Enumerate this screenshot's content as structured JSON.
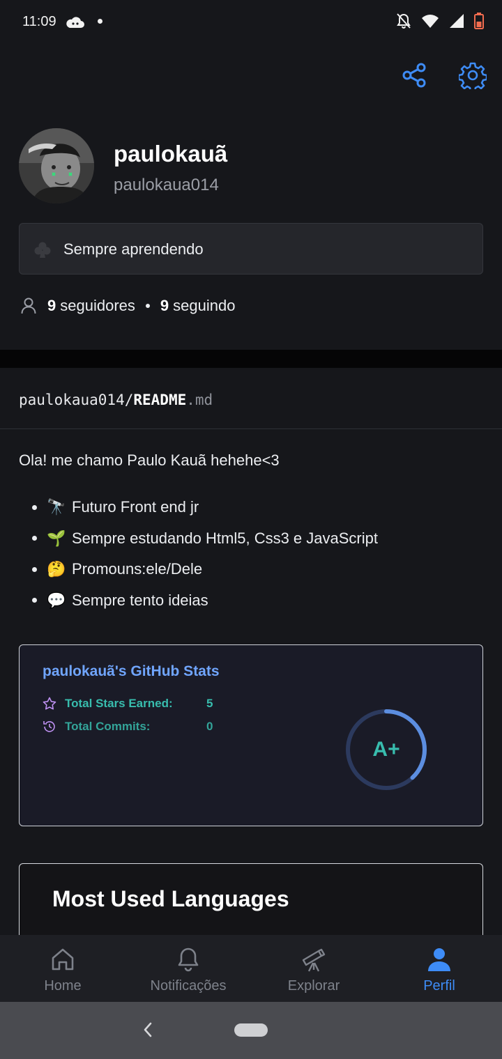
{
  "status_bar": {
    "time": "11:09"
  },
  "profile": {
    "name": "paulokauã",
    "login": "paulokaua014",
    "status_text": "Sempre aprendendo",
    "followers_count": "9",
    "followers_label": "seguidores",
    "following_count": "9",
    "following_label": "seguindo"
  },
  "readme": {
    "path_prefix": "paulokaua014/",
    "path_file": "README",
    "path_ext": ".md",
    "intro": "Ola! me chamo Paulo Kauã hehehe<3",
    "bullets": [
      {
        "emoji": "🔭",
        "text": "Futuro Front end jr"
      },
      {
        "emoji": "🌱",
        "text": "Sempre estudando Html5, Css3 e JavaScript"
      },
      {
        "emoji": "🤔",
        "text": "Promouns:ele/Dele"
      },
      {
        "emoji": "💬",
        "text": "Sempre tento ideias"
      }
    ]
  },
  "stats_card": {
    "title": "paulokauã's GitHub Stats",
    "rows": [
      {
        "icon": "star-icon",
        "label": "Total Stars Earned:",
        "value": "5"
      },
      {
        "icon": "history-icon",
        "label": "Total Commits:",
        "value": "0"
      }
    ],
    "rank": "A+",
    "rank_progress": 0.38,
    "colors": {
      "title": "#70a5fd",
      "text": "#38bdae",
      "icon": "#bf91f3",
      "background": "#1a1b27"
    }
  },
  "languages_card": {
    "title": "Most Used Languages"
  },
  "bottom_nav": {
    "items": [
      {
        "icon": "home-icon",
        "label": "Home",
        "active": false
      },
      {
        "icon": "bell-icon",
        "label": "Notificações",
        "active": false
      },
      {
        "icon": "telescope-icon",
        "label": "Explorar",
        "active": false
      },
      {
        "icon": "person-icon",
        "label": "Perfil",
        "active": true
      }
    ]
  },
  "colors": {
    "accent": "#3e8cf6",
    "background": "#16171b"
  }
}
